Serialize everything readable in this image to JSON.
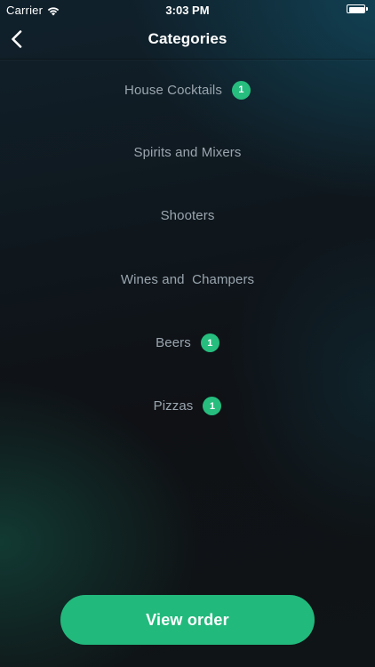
{
  "status_bar": {
    "carrier": "Carrier",
    "time": "3:03 PM",
    "wifi_icon": "wifi-icon",
    "battery_icon": "battery-icon",
    "battery_level": 1.0
  },
  "nav": {
    "back_icon": "chevron-left-icon",
    "title": "Categories"
  },
  "categories": [
    {
      "label": "House Cocktails",
      "badge": "1"
    },
    {
      "label": "Spirits and Mixers",
      "badge": null
    },
    {
      "label": "Shooters",
      "badge": null
    },
    {
      "label": "Wines and  Champers",
      "badge": null
    },
    {
      "label": "Beers",
      "badge": "1"
    },
    {
      "label": "Pizzas",
      "badge": "1"
    }
  ],
  "footer": {
    "view_order_label": "View order"
  },
  "colors": {
    "accent": "#22b97c",
    "badge": "#26bd7e",
    "category_text": "#9aa5ae",
    "background_dark": "#0f1115"
  }
}
